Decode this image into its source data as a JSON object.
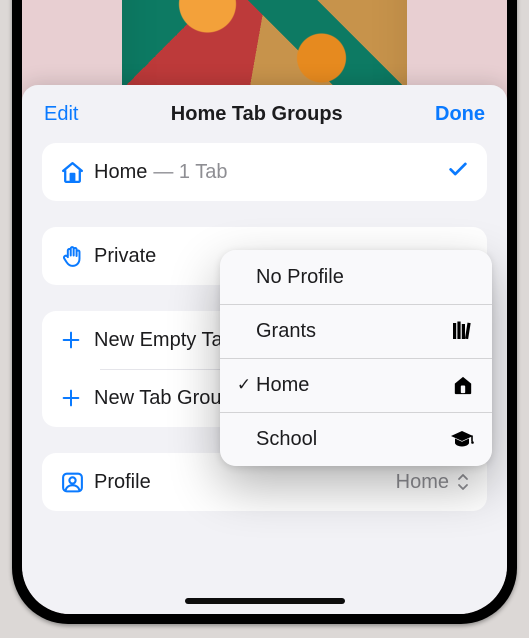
{
  "header": {
    "edit": "Edit",
    "title": "Home Tab Groups",
    "done": "Done"
  },
  "groups": {
    "home": {
      "label": "Home",
      "subtitle": "— 1 Tab"
    },
    "private": {
      "label": "Private"
    }
  },
  "actions": {
    "new_empty": "New Empty Tab Group",
    "new_from": "New Tab Group from 1 Tab"
  },
  "profile_row": {
    "label": "Profile",
    "value": "Home"
  },
  "popover": {
    "items": [
      {
        "label": "No Profile",
        "icon": null,
        "checked": false
      },
      {
        "label": "Grants",
        "icon": "books",
        "checked": false
      },
      {
        "label": "Home",
        "icon": "house",
        "checked": true
      },
      {
        "label": "School",
        "icon": "gradcap",
        "checked": false
      }
    ]
  },
  "colors": {
    "accent": "#0a7aff"
  }
}
